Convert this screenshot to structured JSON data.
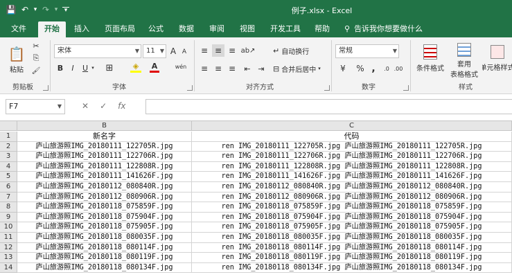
{
  "titlebar": {
    "window_title": "例子.xlsx  -  Excel",
    "save_icon": "💾",
    "undo_icon": "↶",
    "undo_drop_icon": "▾",
    "redo_icon": "↷",
    "customize_icon": "▾"
  },
  "tabs": [
    {
      "label": "文件",
      "active": false
    },
    {
      "label": "开始",
      "active": true
    },
    {
      "label": "插入",
      "active": false
    },
    {
      "label": "页面布局",
      "active": false
    },
    {
      "label": "公式",
      "active": false
    },
    {
      "label": "数据",
      "active": false
    },
    {
      "label": "审阅",
      "active": false
    },
    {
      "label": "视图",
      "active": false
    },
    {
      "label": "开发工具",
      "active": false
    },
    {
      "label": "帮助",
      "active": false
    }
  ],
  "tell_me": {
    "icon": "⚲",
    "text": "告诉我你想要做什么"
  },
  "ribbon": {
    "clipboard": {
      "label": "剪贴板",
      "paste_label": "粘贴",
      "paste_icon": "📋",
      "cut_icon": "✂",
      "copy_icon": "⎘",
      "format_painter_icon": "🖌"
    },
    "font": {
      "label": "字体",
      "font_name": "宋体",
      "font_size": "11",
      "grow_icon": "A",
      "shrink_icon": "A",
      "bold": "B",
      "italic": "I",
      "underline": "U",
      "border_icon": "⊞",
      "fill_icon": "◈",
      "font_color_icon": "A",
      "wen_icon": "wén",
      "launcher": ""
    },
    "alignment": {
      "label": "对齐方式",
      "wrap_text": "自动换行",
      "merge_center": "合并后居中",
      "wrap_icon": "↵",
      "merge_icon": "⊟"
    },
    "number": {
      "label": "数字",
      "format": "常规",
      "currency_icon": "¥",
      "percent_icon": "%",
      "comma_icon": ",",
      "inc_decimal": ".0",
      "dec_decimal": ".00"
    },
    "styles": {
      "label": "样式",
      "conditional": "条件格式",
      "as_table_1": "套用",
      "as_table_2": "表格格式",
      "cell_styles": "单元格样式"
    }
  },
  "formula_bar": {
    "name_box": "F7",
    "cancel_icon": "✕",
    "enter_icon": "✓",
    "fx_icon": "fx",
    "value": ""
  },
  "grid": {
    "columns": [
      "B",
      "C"
    ],
    "header_row": {
      "row": "1",
      "b": "新名字",
      "c": "代码"
    },
    "rows": [
      {
        "row": "2",
        "b": "庐山旅游照IMG_20180111_122705R.jpg",
        "c": "ren IMG_20180111_122705R.jpg 庐山旅游照IMG_20180111_122705R.jpg"
      },
      {
        "row": "3",
        "b": "庐山旅游照IMG_20180111_122706R.jpg",
        "c": "ren IMG_20180111_122706R.jpg 庐山旅游照IMG_20180111_122706R.jpg"
      },
      {
        "row": "4",
        "b": "庐山旅游照IMG_20180111_122808R.jpg",
        "c": "ren IMG_20180111_122808R.jpg 庐山旅游照IMG_20180111_122808R.jpg"
      },
      {
        "row": "5",
        "b": "庐山旅游照IMG_20180111_141626F.jpg",
        "c": "ren IMG_20180111_141626F.jpg 庐山旅游照IMG_20180111_141626F.jpg"
      },
      {
        "row": "6",
        "b": "庐山旅游照IMG_20180112_080840R.jpg",
        "c": "ren IMG_20180112_080840R.jpg 庐山旅游照IMG_20180112_080840R.jpg"
      },
      {
        "row": "7",
        "b": "庐山旅游照IMG_20180112_080906R.jpg",
        "c": "ren IMG_20180112_080906R.jpg 庐山旅游照IMG_20180112_080906R.jpg"
      },
      {
        "row": "8",
        "b": "庐山旅游照IMG_20180118_075859F.jpg",
        "c": "ren IMG_20180118_075859F.jpg 庐山旅游照IMG_20180118_075859F.jpg"
      },
      {
        "row": "9",
        "b": "庐山旅游照IMG_20180118_075904F.jpg",
        "c": "ren IMG_20180118_075904F.jpg 庐山旅游照IMG_20180118_075904F.jpg"
      },
      {
        "row": "10",
        "b": "庐山旅游照IMG_20180118_075905F.jpg",
        "c": "ren IMG_20180118_075905F.jpg 庐山旅游照IMG_20180118_075905F.jpg"
      },
      {
        "row": "11",
        "b": "庐山旅游照IMG_20180118_080035F.jpg",
        "c": "ren IMG_20180118_080035F.jpg 庐山旅游照IMG_20180118_080035F.jpg"
      },
      {
        "row": "12",
        "b": "庐山旅游照IMG_20180118_080114F.jpg",
        "c": "ren IMG_20180118_080114F.jpg 庐山旅游照IMG_20180118_080114F.jpg"
      },
      {
        "row": "13",
        "b": "庐山旅游照IMG_20180118_080119F.jpg",
        "c": "ren IMG_20180118_080119F.jpg 庐山旅游照IMG_20180118_080119F.jpg"
      },
      {
        "row": "14",
        "b": "庐山旅游照IMG_20180118_080134F.jpg",
        "c": "ren IMG_20180118_080134F.jpg 庐山旅游照IMG_20180118_080134F.jpg"
      }
    ]
  },
  "colors": {
    "excel_green": "#217346",
    "ribbon_bg": "#f3f3f3",
    "header_bg": "#e6e6e6"
  }
}
